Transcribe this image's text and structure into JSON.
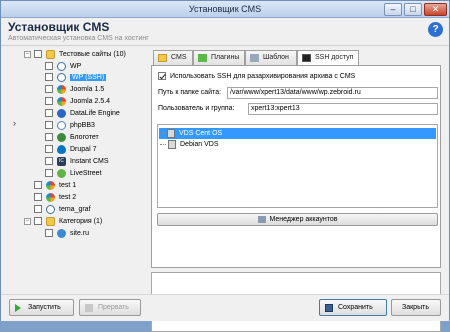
{
  "window": {
    "title": "Установщик CMS",
    "minimize": "–",
    "maximize": "□",
    "close": "✕"
  },
  "header": {
    "title": "Установщик CMS",
    "subtitle": "Автоматическая установка CMS на хостинг",
    "help": "?"
  },
  "tree": {
    "root_expand": "–",
    "root_label": "Тестовые сайты (10)",
    "items": [
      {
        "label": "WP",
        "icon": "wordpress-icon"
      },
      {
        "label": "WP (SSH)",
        "icon": "wordpress-icon",
        "selected": true
      },
      {
        "label": "Joomla 1.5",
        "icon": "joomla-icon"
      },
      {
        "label": "Joomla 2.5.4",
        "icon": "joomla-icon"
      },
      {
        "label": "DataLife Engine",
        "icon": "dle-icon"
      },
      {
        "label": "phpBB3",
        "icon": "phpbb-icon"
      },
      {
        "label": "Блоготет",
        "icon": "blog-icon"
      },
      {
        "label": "Drupal 7",
        "icon": "drupal-icon"
      },
      {
        "label": "Instant CMS",
        "icon": "instantcms-icon"
      },
      {
        "label": "LiveStreet",
        "icon": "livestreet-icon"
      }
    ],
    "others": [
      {
        "label": "test 1",
        "icon": "joomla-icon"
      },
      {
        "label": "test 2",
        "icon": "joomla-icon"
      },
      {
        "label": "tema_graf",
        "icon": "wordpress-icon"
      }
    ],
    "category_expand": "–",
    "category_label": "Категория (1)",
    "category_items": [
      {
        "label": "site.ru",
        "icon": "wordpress-icon"
      }
    ]
  },
  "tabs": [
    {
      "label": "CMS",
      "icon": "folder-icon"
    },
    {
      "label": "Плагины",
      "icon": "puzzle-icon"
    },
    {
      "label": "Шаблон",
      "icon": "template-icon"
    },
    {
      "label": "SSH доступ",
      "icon": "terminal-icon",
      "active": true
    }
  ],
  "ssh": {
    "use_ssh_label": "Использовать SSH для разархивирования архива с CMS",
    "use_ssh_checked": true,
    "path_label": "Путь к папке сайта:",
    "path_value": "/var/www/xpert13/data/www/wp.zebroid.ru",
    "user_label": "Пользователь и группа:",
    "user_value": "xpert13:xpert13",
    "servers": [
      {
        "label": "VDS Cent OS",
        "selected": true
      },
      {
        "label": "Debian VDS",
        "selected": false
      }
    ],
    "manager_button": "Менеджер аккаунтов"
  },
  "footer": {
    "run": "Запустить",
    "stop": "Прервать",
    "save": "Сохранить",
    "close": "Закрыть"
  },
  "colors": {
    "selection": "#3399ff",
    "accent": "#2f6fd0"
  }
}
